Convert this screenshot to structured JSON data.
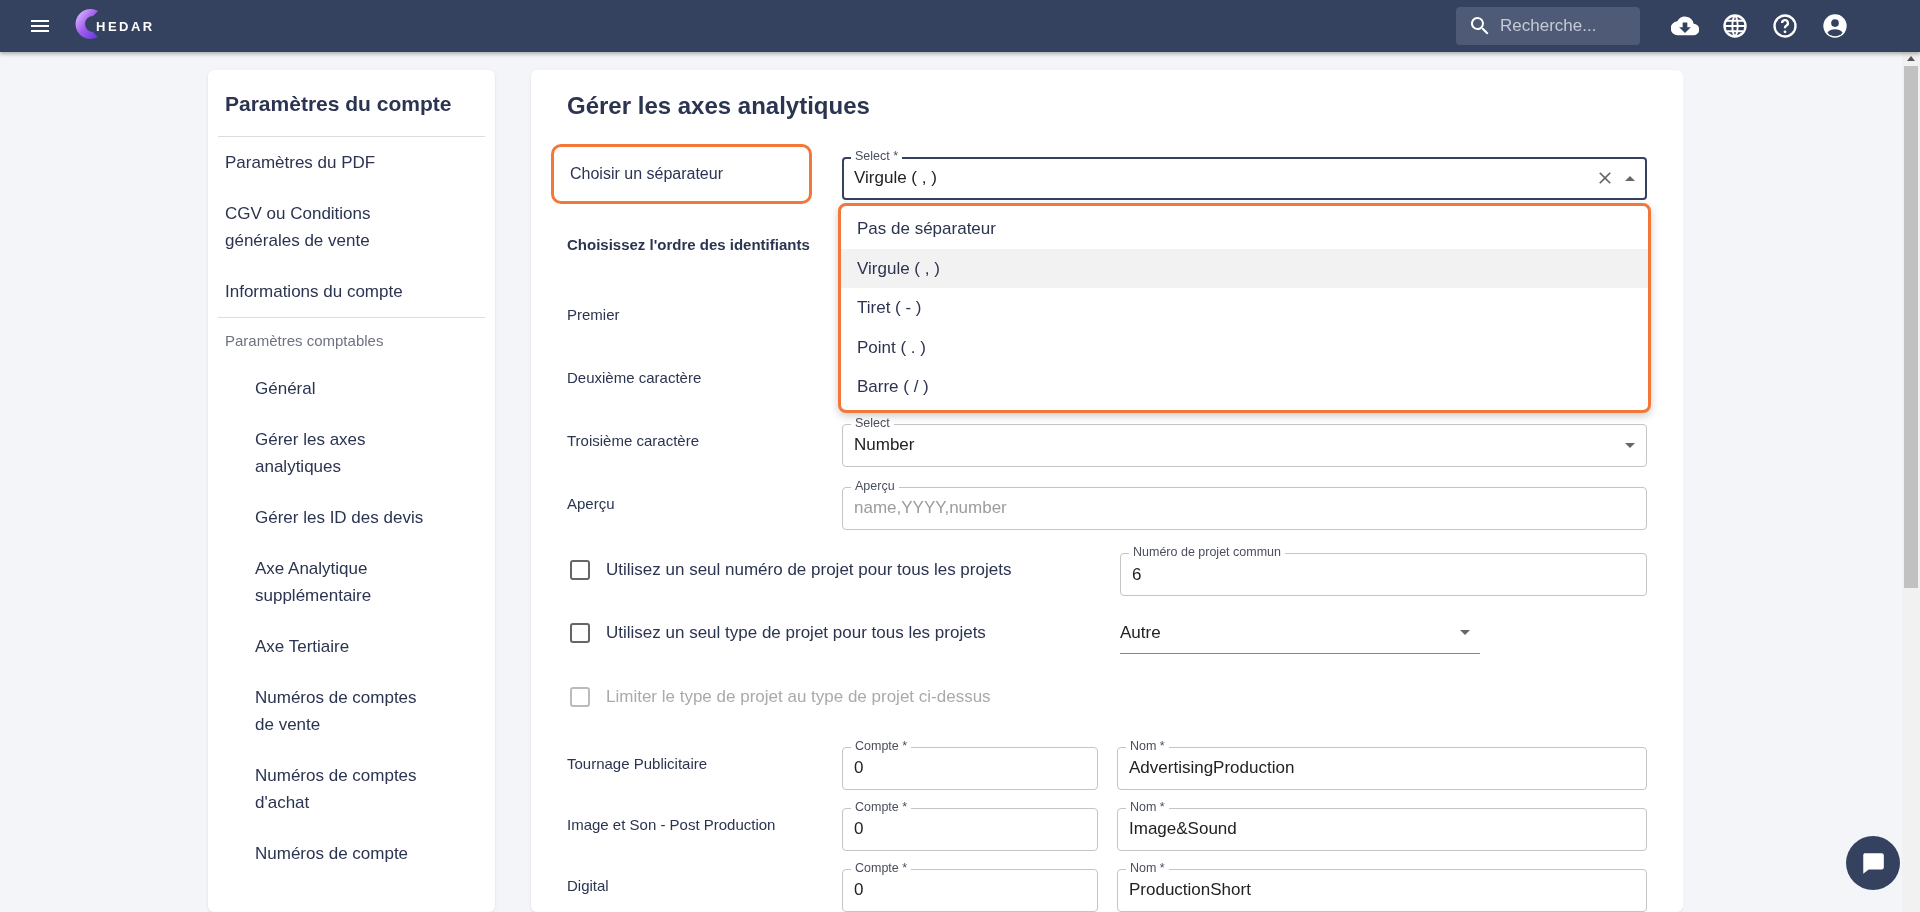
{
  "topbar": {
    "logo_text": "HEDAR",
    "search": {
      "placeholder": "Recherche..."
    }
  },
  "sidebar": {
    "title": "Paramètres du compte",
    "items": [
      {
        "label": "Paramètres du PDF",
        "kind": "item",
        "selected": false
      },
      {
        "label": "CGV ou Conditions générales de vente",
        "kind": "item",
        "selected": false
      },
      {
        "label": "Informations du compte",
        "kind": "item",
        "selected": false
      },
      {
        "label": "Paramètres comptables",
        "kind": "header",
        "children": [
          {
            "label": "Général",
            "selected": false
          },
          {
            "label": "Gérer les axes analytiques",
            "selected": false
          },
          {
            "label": "Gérer les ID des devis",
            "selected": false
          },
          {
            "label": "Axe Analytique supplémentaire",
            "selected": false
          },
          {
            "label": "Axe Tertiaire",
            "selected": false
          },
          {
            "label": "Numéros de comptes de vente",
            "selected": false
          },
          {
            "label": "Numéros de comptes d'achat",
            "selected": false
          },
          {
            "label": "Numéros de compte",
            "selected": false
          }
        ]
      }
    ]
  },
  "main": {
    "title": "Gérer les axes analytiques",
    "separator": {
      "label": "Choisir un séparateur",
      "highlighted": true,
      "field_label": "Select *",
      "value": "Virgule ( , )",
      "expanded": true,
      "options": [
        {
          "label": "Pas de séparateur",
          "selected": false
        },
        {
          "label": "Virgule ( , )",
          "selected": true
        },
        {
          "label": "Tiret ( - )",
          "selected": false
        },
        {
          "label": "Point ( . )",
          "selected": false
        },
        {
          "label": "Barre ( / )",
          "selected": false
        }
      ],
      "options_highlighted": true
    },
    "order_heading": "Choisissez l'ordre des identifiants",
    "order_rows": [
      {
        "label": "Premier"
      },
      {
        "label": "Deuxième caractère"
      },
      {
        "label": "Troisième caractère",
        "field_label": "Select",
        "value": "Number"
      }
    ],
    "preview": {
      "label": "Aperçu",
      "field_label": "Aperçu",
      "placeholder": "name,YYYY,number"
    },
    "options": [
      {
        "kind": "field",
        "label": "Utilisez un seul numéro de projet pour tous les projets",
        "checked": false,
        "disabled": false,
        "field_label": "Numéro de projet commun",
        "value": "6"
      },
      {
        "kind": "select",
        "label": "Utilisez un seul type de projet pour tous les projets",
        "checked": false,
        "disabled": false,
        "value": "Autre"
      },
      {
        "kind": "plain",
        "label": "Limiter le type de projet au type de projet ci-dessus",
        "checked": false,
        "disabled": true
      }
    ],
    "project_types": [
      {
        "label": "Tournage Publicitaire",
        "account_label": "Compte *",
        "account": "0",
        "name_label": "Nom *",
        "name": "AdvertisingProduction"
      },
      {
        "label": "Image et Son - Post Production",
        "account_label": "Compte *",
        "account": "0",
        "name_label": "Nom *",
        "name": "Image&Sound"
      },
      {
        "label": "Digital",
        "account_label": "Compte *",
        "account": "0",
        "name_label": "Nom *",
        "name": "ProductionShort"
      }
    ]
  }
}
